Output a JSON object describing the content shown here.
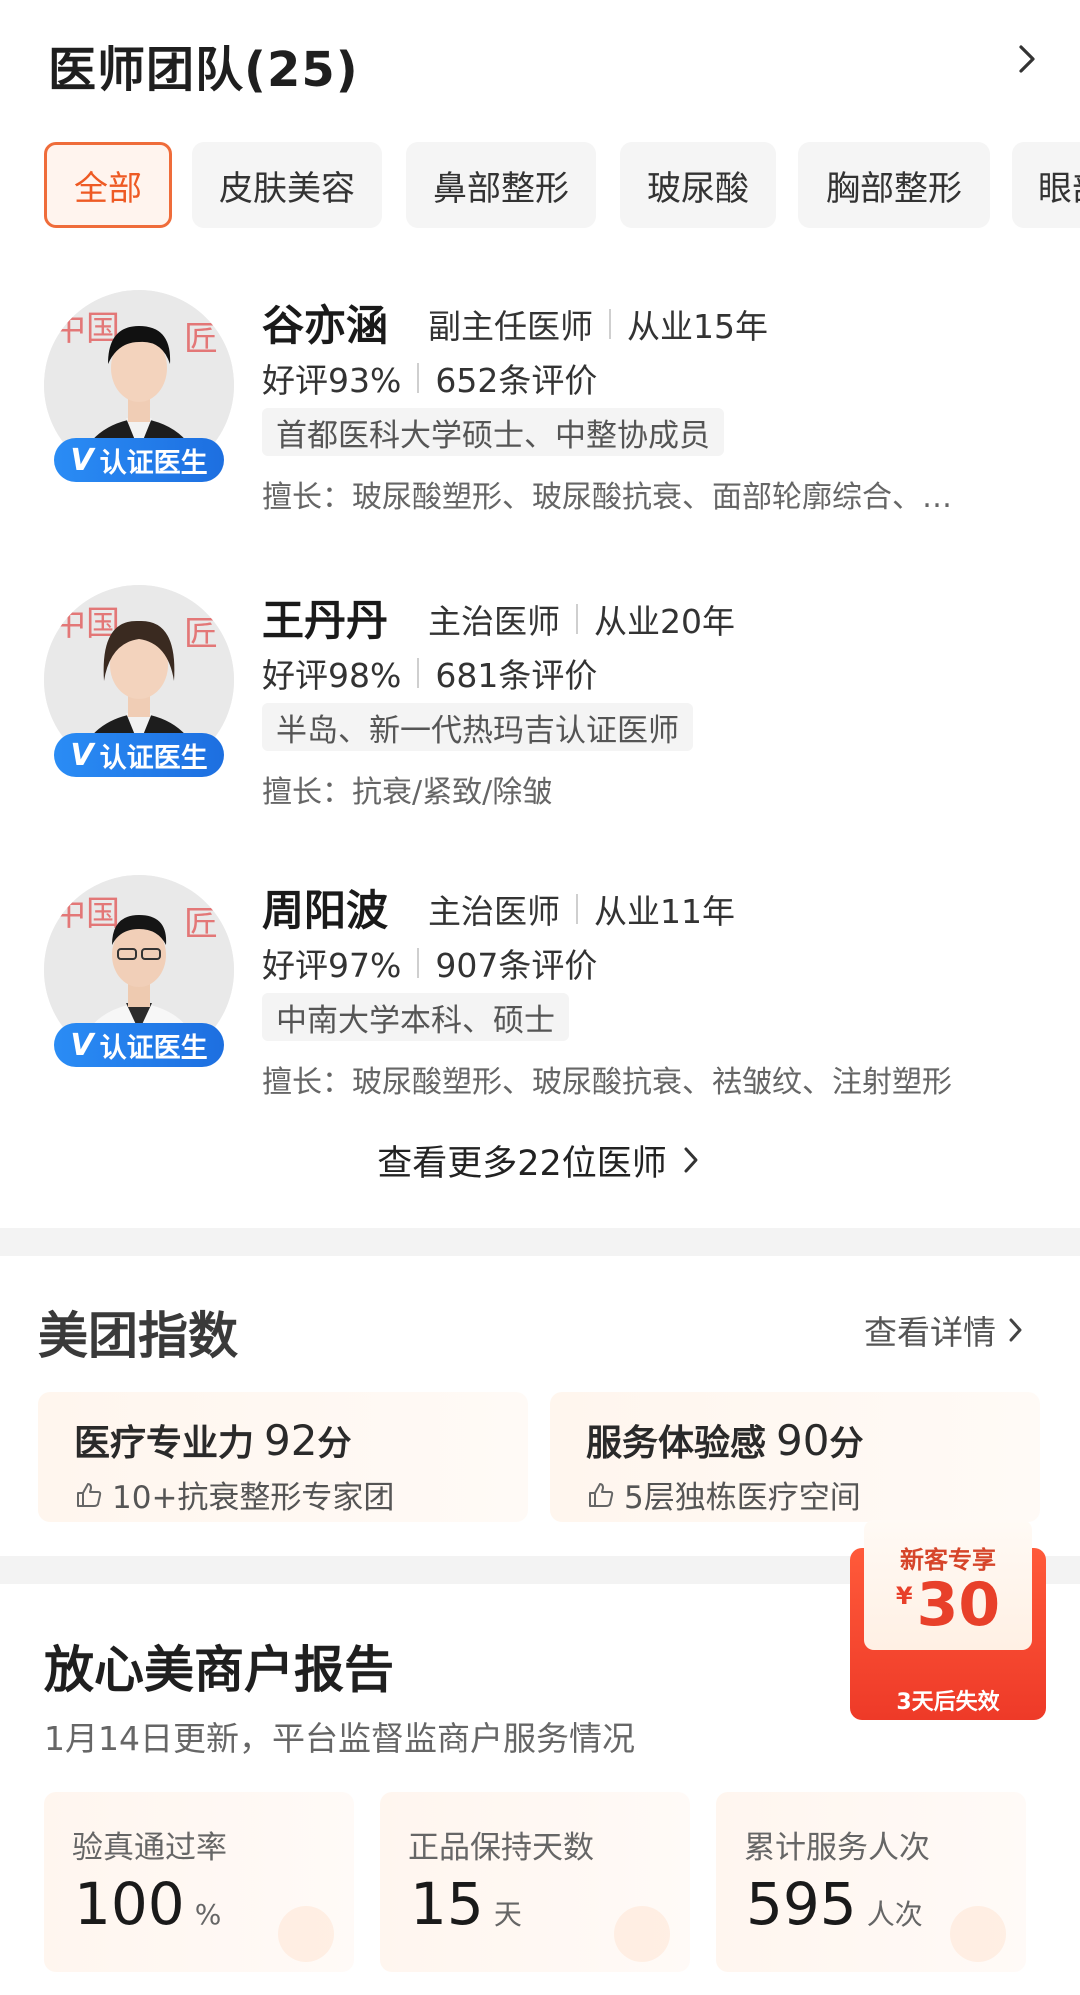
{
  "team": {
    "title": "医师团队(25)",
    "tabs": [
      {
        "label": "全部",
        "active": true
      },
      {
        "label": "皮肤美容",
        "active": false
      },
      {
        "label": "鼻部整形",
        "active": false
      },
      {
        "label": "玻尿酸",
        "active": false
      },
      {
        "label": "胸部整形",
        "active": false
      },
      {
        "label": "眼部",
        "active": false
      }
    ],
    "cert_label": "认证医生",
    "cert_mark": "V",
    "doctors": [
      {
        "name": "谷亦涵",
        "title": "副主任医师",
        "years": "从业15年",
        "rating": "好评93%",
        "reviews": "652条评价",
        "tag": "首都医科大学硕士、中整协成员",
        "skill": "擅长：玻尿酸塑形、玻尿酸抗衰、面部轮廓综合、…",
        "avatar_icon": "doctor-portrait-female"
      },
      {
        "name": "王丹丹",
        "title": "主治医师",
        "years": "从业20年",
        "rating": "好评98%",
        "reviews": "681条评价",
        "tag": "半岛、新一代热玛吉认证医师",
        "skill": "擅长：抗衰/紧致/除皱",
        "avatar_icon": "doctor-portrait-female"
      },
      {
        "name": "周阳波",
        "title": "主治医师",
        "years": "从业11年",
        "rating": "好评97%",
        "reviews": "907条评价",
        "tag": "中南大学本科、硕士",
        "skill": "擅长：玻尿酸塑形、玻尿酸抗衰、祛皱纹、注射塑形",
        "avatar_icon": "doctor-portrait-male"
      }
    ],
    "more_label": "查看更多22位医师"
  },
  "index": {
    "title": "美团指数",
    "detail_label": "查看详情",
    "cards": [
      {
        "label": "医疗专业力",
        "score": "92",
        "unit": "分",
        "sub": "10+抗衰整形专家团"
      },
      {
        "label": "服务体验感",
        "score": "90",
        "unit": "分",
        "sub": "5层独栋医疗空间"
      }
    ]
  },
  "report": {
    "title": "放心美商户报告",
    "subtitle": "1月14日更新，平台监督监商户服务情况",
    "stats": [
      {
        "label": "验真通过率",
        "value": "100",
        "unit": "%"
      },
      {
        "label": "正品保持天数",
        "value": "15",
        "unit": "天"
      },
      {
        "label": "累计服务人次",
        "value": "595",
        "unit": "人次"
      }
    ]
  },
  "coupon": {
    "label": "新客专享",
    "currency": "¥",
    "amount": "30",
    "expire": "3天后失效"
  },
  "colors": {
    "accent": "#ee5a24",
    "cert_blue": "#1d6fe0",
    "coupon_red": "#ee3a28"
  }
}
